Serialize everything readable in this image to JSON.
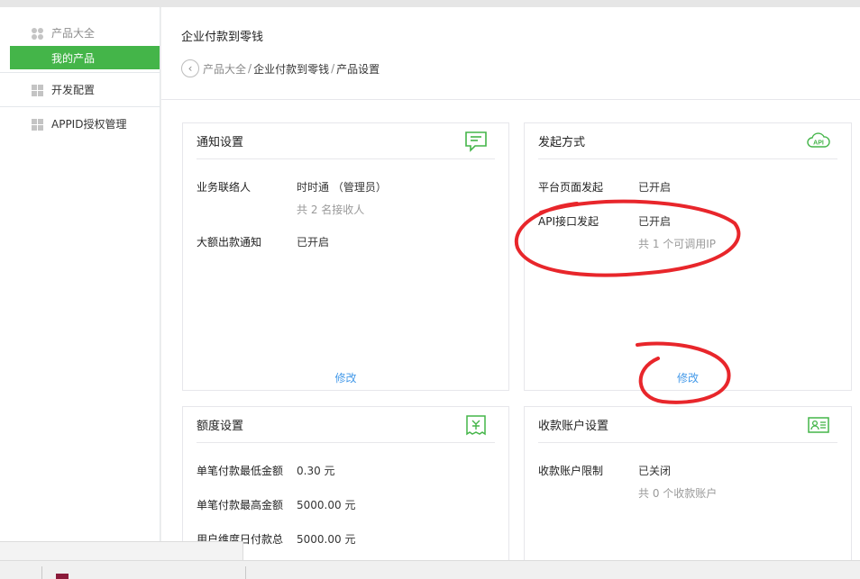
{
  "sidebar": {
    "group1": {
      "label": "产品大全",
      "active_sub": "我的产品"
    },
    "group2": {
      "label": "开发配置"
    },
    "group3": {
      "label": "APPID授权管理"
    }
  },
  "header": {
    "title": "企业付款到零钱",
    "breadcrumb": [
      "产品大全",
      "企业付款到零钱",
      "产品设置"
    ],
    "sep": "/"
  },
  "cards": {
    "notify": {
      "title": "通知设置",
      "icon": "message-icon",
      "contact_label": "业务联络人",
      "contact_value": "时时通 （管理员）",
      "contact_sub": "共 2 名接收人",
      "large_label": "大额出款通知",
      "large_value": "已开启",
      "edit": "修改"
    },
    "initiate": {
      "title": "发起方式",
      "icon": "api-cloud-icon",
      "icon_text": "API",
      "platform_label": "平台页面发起",
      "platform_value": "已开启",
      "api_label": "API接口发起",
      "api_value": "已开启",
      "api_sub": "共 1 个可调用IP",
      "edit": "修改"
    },
    "quota": {
      "title": "额度设置",
      "icon": "receipt-icon",
      "min_label": "单笔付款最低金额",
      "min_value": "0.30 元",
      "max_label": "单笔付款最高金额",
      "max_value": "5000.00 元",
      "daily_label": "用户维度日付款总",
      "daily_value": "5000.00 元"
    },
    "account": {
      "title": "收款账户设置",
      "icon": "id-card-icon",
      "limit_label": "收款账户限制",
      "limit_value": "已关闭",
      "limit_sub": "共 0 个收款账户"
    }
  },
  "colors": {
    "accent": "#44b549",
    "link": "#459ae9",
    "annotation": "#e8262b"
  }
}
